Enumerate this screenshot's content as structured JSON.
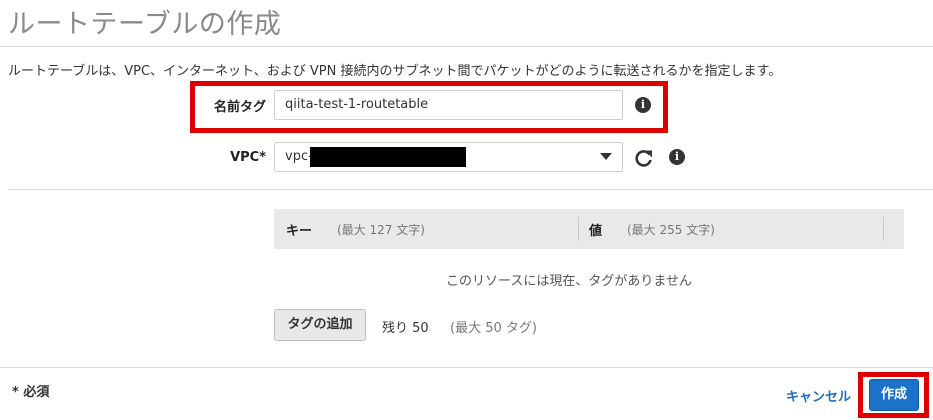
{
  "page": {
    "title": "ルートテーブルの作成",
    "description": "ルートテーブルは、VPC、インターネット、および VPN 接続内のサブネット間でパケットがどのように転送されるかを指定します。"
  },
  "form": {
    "name_tag": {
      "label": "名前タグ",
      "value": "qiita-test-1-routetable",
      "info_icon": "info-icon"
    },
    "vpc": {
      "label": "VPC*",
      "value_prefix": "vpc-",
      "refresh_icon": "refresh-icon",
      "dropdown_icon": "caret-down-icon",
      "info_icon": "info-icon"
    }
  },
  "tags": {
    "columns": [
      {
        "name": "キー",
        "hint": "(最大 127 文字)"
      },
      {
        "name": "値",
        "hint": "(最大 255 文字)"
      }
    ],
    "empty_message": "このリソースには現在、タグがありません",
    "add_button": "タグの追加",
    "remaining": "残り 50",
    "max": "(最大 50 タグ)"
  },
  "footer": {
    "required_note": "* 必須",
    "cancel": "キャンセル",
    "create": "作成"
  },
  "colors": {
    "highlight": "#dd0000",
    "primary": "#1a73c9",
    "link": "#1a6fc2"
  }
}
